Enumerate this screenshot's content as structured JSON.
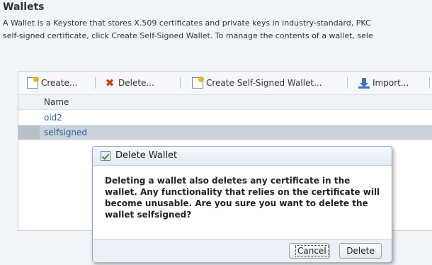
{
  "page": {
    "title": "Wallets",
    "description_line1": "A Wallet is a Keystore that stores X.509 certificates and private keys in industry-standard, PKC",
    "description_line2": "self-signed certificate, click Create Self-Signed Wallet. To manage the contents of a wallet, sele"
  },
  "toolbar": {
    "create_label": "Create...",
    "delete_label": "Delete...",
    "create_self_signed_label": "Create Self-Signed Wallet...",
    "import_label": "Import..."
  },
  "table": {
    "column_name": "Name",
    "rows": [
      {
        "name": "oid2",
        "selected": false
      },
      {
        "name": "selfsigned",
        "selected": true
      }
    ]
  },
  "dialog": {
    "title": "Delete Wallet",
    "message": "Deleting a wallet also deletes any certificate in the wallet. Any functionality that relies on the certificate will become unusable. Are you sure you want to delete the wallet selfsigned?",
    "cancel_label": "Cancel",
    "delete_label": "Delete"
  },
  "colors": {
    "page_background": "#f1f4f8",
    "link": "#2a5f9e",
    "selected_row": "#c9d2db",
    "dialog_border": "#93a8c2"
  }
}
